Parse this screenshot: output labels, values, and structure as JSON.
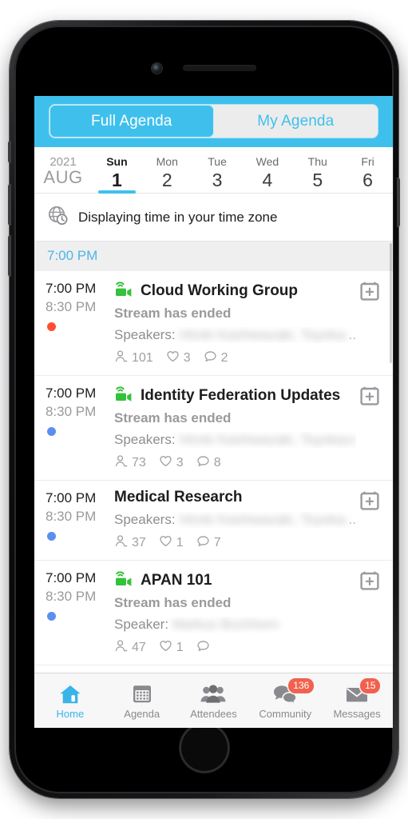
{
  "colors": {
    "accent": "#3FC0EC",
    "badge": "#F2614F",
    "live_green": "#34C13B",
    "dot_red": "#FF4F32",
    "dot_blue": "#5B8FEF",
    "section_bg": "#EFEFF0"
  },
  "header": {
    "tabs": [
      {
        "label": "Full Agenda",
        "active": true
      },
      {
        "label": "My Agenda",
        "active": false
      }
    ]
  },
  "datestrip": {
    "year": "2021",
    "month": "AUG",
    "days": [
      {
        "dow": "Sun",
        "num": "1",
        "selected": true
      },
      {
        "dow": "Mon",
        "num": "2",
        "selected": false
      },
      {
        "dow": "Tue",
        "num": "3",
        "selected": false
      },
      {
        "dow": "Wed",
        "num": "4",
        "selected": false
      },
      {
        "dow": "Thu",
        "num": "5",
        "selected": false
      },
      {
        "dow": "Fri",
        "num": "6",
        "selected": false
      }
    ]
  },
  "timezone_banner": {
    "icon": "globe-clock-icon",
    "text": "Displaying time in your time zone"
  },
  "agenda": {
    "section_header": "7:00 PM",
    "events": [
      {
        "start": "7:00 PM",
        "end": "8:30 PM",
        "dot_color": "#FF4F32",
        "live_icon": true,
        "title": "Cloud Working Group",
        "status": "Stream has ended",
        "speakers_label": "Speakers:",
        "speakers_names": "Hiroki Kashiwazaki, Toyokazu S.",
        "speakers_truncated": true,
        "attendees": "101",
        "likes": "3",
        "comments": "2",
        "calendar_action": "add-to-calendar"
      },
      {
        "start": "7:00 PM",
        "end": "8:30 PM",
        "dot_color": "#5B8FEF",
        "live_icon": true,
        "title": "Identity Federation Updates",
        "status": "Stream has ended",
        "speakers_label": "Speakers:",
        "speakers_names": "Hiroki Kashiwazaki, Toyokazu S.",
        "speakers_truncated": false,
        "attendees": "73",
        "likes": "3",
        "comments": "8",
        "calendar_action": "add-to-calendar"
      },
      {
        "start": "7:00 PM",
        "end": "8:30 PM",
        "dot_color": "#5B8FEF",
        "live_icon": false,
        "title": "Medical Research",
        "status": "",
        "speakers_label": "Speakers:",
        "speakers_names": "Hiroki Kashiwazaki, Toyokazu S.",
        "speakers_truncated": true,
        "attendees": "37",
        "likes": "1",
        "comments": "7",
        "calendar_action": "add-to-calendar"
      },
      {
        "start": "7:00 PM",
        "end": "8:30 PM",
        "dot_color": "#5B8FEF",
        "live_icon": true,
        "title": "APAN 101",
        "status": "Stream has ended",
        "speakers_label": "Speaker:",
        "speakers_names": "Markus Buchhorn",
        "speakers_truncated": false,
        "attendees": "47",
        "likes": "1",
        "comments": "",
        "calendar_action": "add-to-calendar"
      }
    ]
  },
  "tabbar": {
    "tabs": [
      {
        "label": "Home",
        "icon": "home-icon",
        "active": true,
        "badge": ""
      },
      {
        "label": "Agenda",
        "icon": "calendar-icon",
        "active": false,
        "badge": ""
      },
      {
        "label": "Attendees",
        "icon": "people-icon",
        "active": false,
        "badge": ""
      },
      {
        "label": "Community",
        "icon": "chat-icon",
        "active": false,
        "badge": "136"
      },
      {
        "label": "Messages",
        "icon": "envelope-icon",
        "active": false,
        "badge": "15"
      }
    ]
  }
}
